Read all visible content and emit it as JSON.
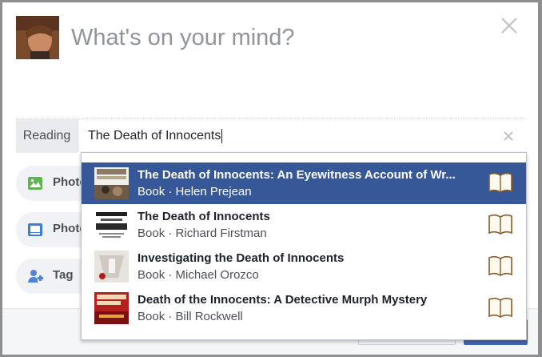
{
  "composer": {
    "placeholder": "What's on your mind?"
  },
  "activity": {
    "label": "Reading",
    "query": "The Death of Innocents"
  },
  "actions": [
    {
      "label": "Photo",
      "icon": "photo-icon"
    },
    {
      "label": "Photo",
      "icon": "photo-album-icon"
    },
    {
      "label": "Tag",
      "icon": "tag-people-icon"
    }
  ],
  "results": [
    {
      "title": "The Death of Innocents: An Eyewitness Account of Wr...",
      "type": "Book",
      "author": "Helen Prejean",
      "selected": true,
      "thumb_color": "#6e5a46",
      "icon": "book-icon"
    },
    {
      "title": "The Death of Innocents",
      "type": "Book",
      "author": "Richard Firstman",
      "selected": false,
      "thumb_color": "#1e1e1e",
      "icon": "book-icon"
    },
    {
      "title": "Investigating the Death of Innocents",
      "type": "Book",
      "author": "Michael Orozco",
      "selected": false,
      "thumb_color": "#d8d4d0",
      "icon": "book-icon"
    },
    {
      "title": "Death of the Innocents: A Detective Murph Mystery",
      "type": "Book",
      "author": "Bill Rockwell",
      "selected": false,
      "thumb_color": "#b3201f",
      "icon": "book-icon"
    }
  ],
  "colors": {
    "accent": "#365899",
    "primary_button": "#4267b2",
    "placeholder_text": "#90949c"
  }
}
